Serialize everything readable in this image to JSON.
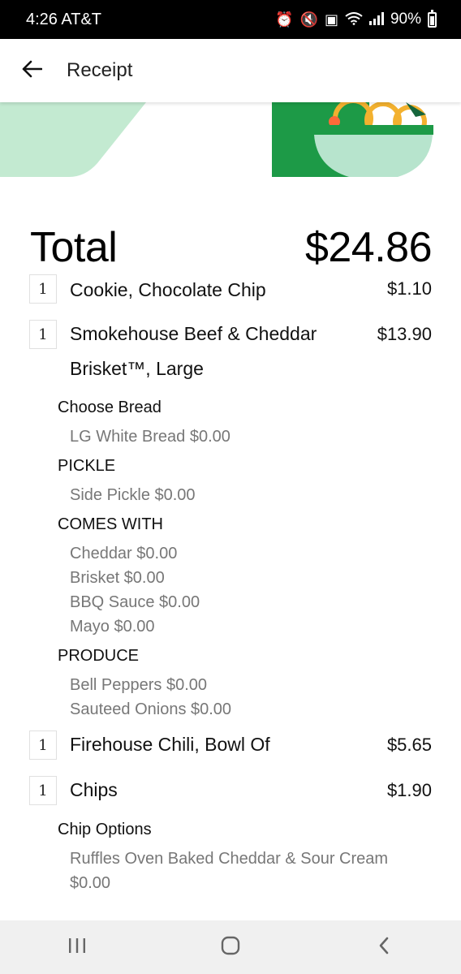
{
  "status_bar": {
    "time": "4:26 AT&T",
    "battery": "90%"
  },
  "header": {
    "title": "Receipt"
  },
  "receipt": {
    "total_label": "Total",
    "total_value": "$24.86",
    "items": [
      {
        "qty": "1",
        "name": "Cookie, Chocolate Chip",
        "price": "$1.10"
      },
      {
        "qty": "1",
        "name_line1": "Smokehouse Beef & Cheddar",
        "name_line2": "Brisket™, Large",
        "price": "$13.90",
        "options": {
          "choose_bread": "Choose Bread",
          "bread_value": "LG White Bread $0.00",
          "pickle": "PICKLE",
          "pickle_value": "Side Pickle $0.00",
          "comes_with": "COMES WITH",
          "comes_with_values": [
            "Cheddar $0.00",
            "Brisket $0.00",
            "BBQ Sauce $0.00",
            "Mayo $0.00"
          ],
          "produce": "PRODUCE",
          "produce_values": [
            "Bell Peppers $0.00",
            "Sauteed Onions $0.00"
          ]
        }
      },
      {
        "qty": "1",
        "name": "Firehouse Chili, Bowl Of",
        "price": "$5.65"
      },
      {
        "qty": "1",
        "name": "Chips",
        "price": "$1.90",
        "options": {
          "chip_options": "Chip Options",
          "chip_value_line1": "Ruffles Oven Baked Cheddar & Sour Cream",
          "chip_value_line2": "$0.00"
        }
      }
    ]
  },
  "colors": {
    "banner_light_green": "#c3ead1",
    "banner_dark_green": "#1d9a47",
    "bowl": "#b7e4cd",
    "noodle": "#f3b12f"
  },
  "icons": {
    "back": "arrow-left-icon",
    "nav_recent": "recent-apps-icon",
    "nav_home": "home-icon",
    "nav_back": "chevron-left-icon"
  }
}
